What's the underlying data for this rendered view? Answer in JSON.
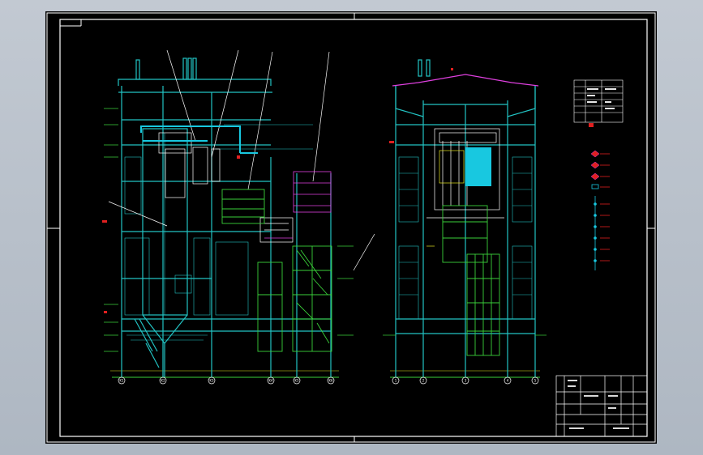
{
  "drawing": {
    "left_view": {
      "axis_labels": [
        "K1",
        "K2",
        "K3",
        "K4",
        "K5",
        "K6"
      ]
    },
    "right_view": {
      "axis_labels": [
        "1",
        "2",
        "3",
        "4",
        "5"
      ]
    },
    "colors": {
      "background": "#000000",
      "frame": "#ffffff",
      "structure": "#22c3c3",
      "floor_green": "#3ad13a",
      "magenta": "#e040e0",
      "red": "#e02020",
      "yellow": "#e6e620",
      "cyan_block": "#18c8e0"
    }
  }
}
